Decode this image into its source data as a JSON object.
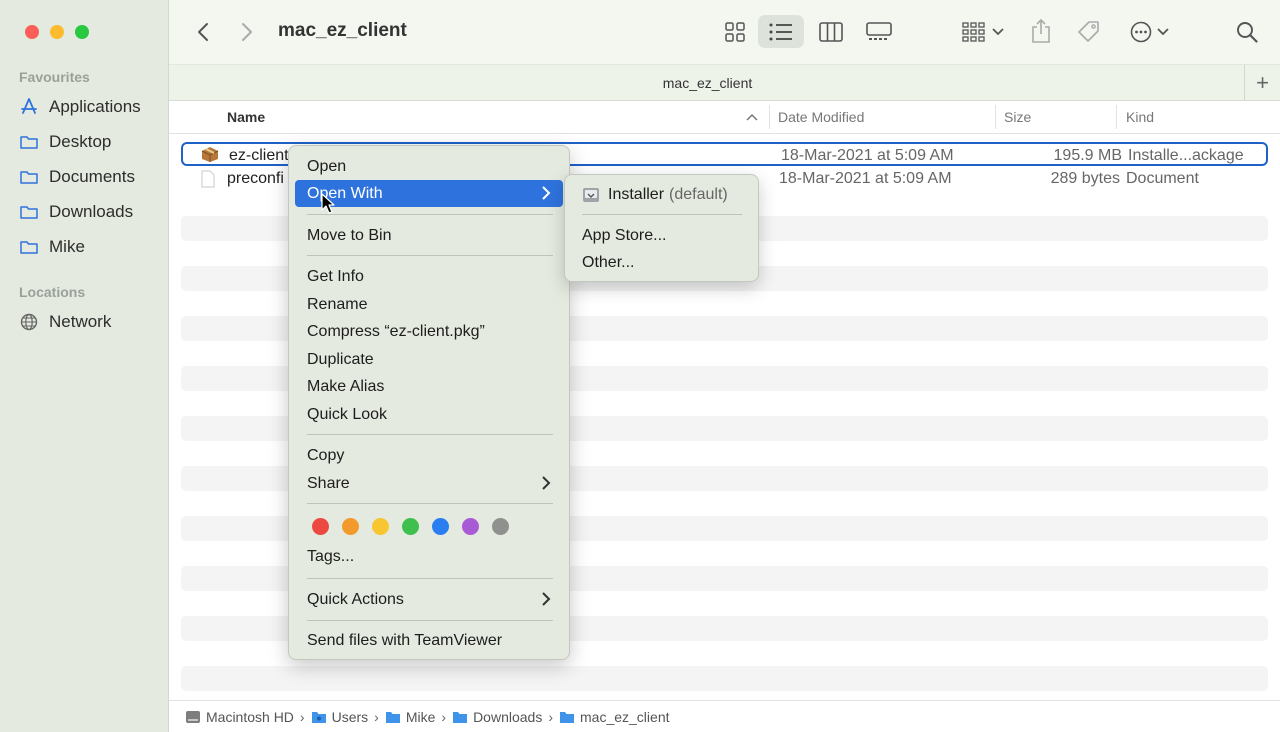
{
  "window": {
    "title": "mac_ez_client",
    "tab_title": "mac_ez_client",
    "tab_add": "+"
  },
  "sidebar": {
    "favourites_heading": "Favourites",
    "favourites": [
      {
        "label": "Applications",
        "icon": "applications-icon"
      },
      {
        "label": "Desktop",
        "icon": "folder-icon"
      },
      {
        "label": "Documents",
        "icon": "folder-icon"
      },
      {
        "label": "Downloads",
        "icon": "folder-icon"
      },
      {
        "label": "Mike",
        "icon": "folder-icon"
      }
    ],
    "locations_heading": "Locations",
    "locations": [
      {
        "label": "Network",
        "icon": "globe-icon"
      }
    ]
  },
  "columns": {
    "name": "Name",
    "date": "Date Modified",
    "size": "Size",
    "kind": "Kind"
  },
  "files": [
    {
      "name": "ez-client",
      "date": "18-Mar-2021 at 5:09 AM",
      "size": "195.9 MB",
      "kind": "Installe...ackage",
      "selected": true,
      "icon": "package-icon"
    },
    {
      "name": "preconfi",
      "date": "18-Mar-2021 at 5:09 AM",
      "size": "289 bytes",
      "kind": "Document",
      "selected": false,
      "icon": "document-icon"
    }
  ],
  "context_menu": {
    "open": "Open",
    "open_with": "Open With",
    "move_to_bin": "Move to Bin",
    "get_info": "Get Info",
    "rename": "Rename",
    "compress": "Compress “ez-client.pkg”",
    "duplicate": "Duplicate",
    "make_alias": "Make Alias",
    "quick_look": "Quick Look",
    "copy": "Copy",
    "share": "Share",
    "tags": "Tags...",
    "quick_actions": "Quick Actions",
    "send_teamviewer": "Send files with TeamViewer",
    "tag_colors": [
      "#ec4a41",
      "#f39a2c",
      "#f7c631",
      "#3fc04e",
      "#2a7ef0",
      "#a95bd5",
      "#8f918f"
    ]
  },
  "open_with_menu": {
    "installer": "Installer",
    "installer_suffix": "(default)",
    "app_store": "App Store...",
    "other": "Other..."
  },
  "pathbar": [
    "Macintosh HD",
    "Users",
    "Mike",
    "Downloads",
    "mac_ez_client"
  ],
  "colors": {
    "accent": "#2e73dd",
    "selection_border": "#1e62c7",
    "sidebar_bg": "#e4eadf"
  }
}
